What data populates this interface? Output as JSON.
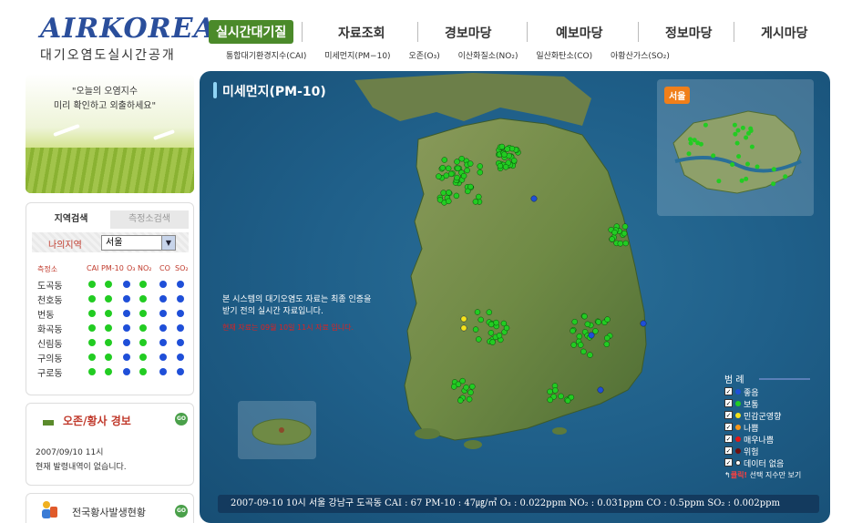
{
  "logo": {
    "main": "AIRKOREA",
    "sub": "대기오염도실시간공개"
  },
  "menu": [
    {
      "label": "실시간대기질",
      "active": true
    },
    {
      "label": "자료조회"
    },
    {
      "label": "경보마당"
    },
    {
      "label": "예보마당"
    },
    {
      "label": "정보마당"
    },
    {
      "label": "게시마당"
    }
  ],
  "submenu": [
    "통합대기환경지수(CAI)",
    "미세먼지(PM−10)",
    "오존(O₃)",
    "이산화질소(NO₂)",
    "일산화탄소(CO)",
    "아황산가스(SO₂)"
  ],
  "banner": {
    "line1": "\"오늘의 오염지수",
    "line2": "미리 확인하고 외출하세요\""
  },
  "search": {
    "tab_region": "지역검색",
    "tab_station": "측정소검색",
    "region_label": "나의지역",
    "region_value": "서울",
    "headers": [
      "측정소",
      "CAI",
      "PM-10",
      "O₃",
      "NO₂",
      "CO",
      "SO₂"
    ],
    "stations": [
      {
        "name": "도곡동",
        "levels": [
          "good-green",
          "good-green",
          "blue",
          "good-green",
          "blue",
          "blue"
        ]
      },
      {
        "name": "천호동",
        "levels": [
          "good-green",
          "good-green",
          "blue",
          "good-green",
          "blue",
          "blue"
        ]
      },
      {
        "name": "번동",
        "levels": [
          "good-green",
          "good-green",
          "blue",
          "good-green",
          "blue",
          "blue"
        ]
      },
      {
        "name": "화곡동",
        "levels": [
          "good-green",
          "good-green",
          "blue",
          "good-green",
          "blue",
          "blue"
        ]
      },
      {
        "name": "신림동",
        "levels": [
          "good-green",
          "good-green",
          "blue",
          "good-green",
          "blue",
          "blue"
        ]
      },
      {
        "name": "구의동",
        "levels": [
          "good-green",
          "good-green",
          "blue",
          "good-green",
          "blue",
          "blue"
        ]
      },
      {
        "name": "구로동",
        "levels": [
          "good-green",
          "good-green",
          "blue",
          "good-green",
          "blue",
          "blue"
        ]
      }
    ]
  },
  "ozone": {
    "title": "오존/황사 경보",
    "date": "2007/09/10 11시",
    "message": "현재 발령내역이 없습니다.",
    "go": "GO"
  },
  "dust": {
    "title": "전국황사발생현황",
    "go": "GO"
  },
  "map": {
    "title": "미세먼지(PM-10)",
    "seoul_label": "서울",
    "notice_line1": "본 시스템의 대기오염도 자료는 최종 인증을",
    "notice_line2": "받기 전의 실시간 자료입니다.",
    "notice_red": "현재 자료는 09월 10일 11시 자료 입니다."
  },
  "legend": {
    "title": "범 례",
    "items": [
      {
        "label": "좋음",
        "color": "#1f4fd8"
      },
      {
        "label": "보통",
        "color": "#22cc22"
      },
      {
        "label": "민감군영향",
        "color": "#f5e21a"
      },
      {
        "label": "나쁨",
        "color": "#f5961a"
      },
      {
        "label": "매우나쁨",
        "color": "#e01818"
      },
      {
        "label": "위험",
        "color": "#6e1010"
      },
      {
        "label": "데이터 없음",
        "color": "#ffffff"
      }
    ],
    "click_red": "클릭!",
    "click_text": " 선택 지수만 보기"
  },
  "status_bar": "2007-09-10 10시 서울 강남구 도곡동 CAI : 67  PM-10 : 47㎍/㎥ O₃ : 0.022ppm  NO₂ : 0.031ppm CO : 0.5ppm SO₂ : 0.002ppm"
}
